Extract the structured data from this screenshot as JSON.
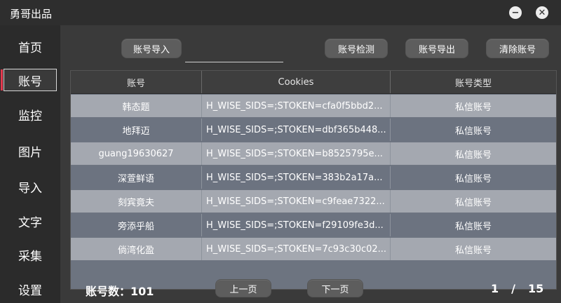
{
  "app_title": "勇哥出品",
  "window_controls": {
    "minimize": "−",
    "close": "✕"
  },
  "sidebar": {
    "items": [
      {
        "label": "首页"
      },
      {
        "label": "账号"
      },
      {
        "label": "监控"
      },
      {
        "label": "图片"
      },
      {
        "label": "导入"
      },
      {
        "label": "文字"
      },
      {
        "label": "采集"
      },
      {
        "label": "设置"
      }
    ],
    "active_index": 1,
    "accent": "#e33a4f"
  },
  "toolbar": {
    "import_label": "账号导入",
    "import_value": "",
    "detect_label": "账号检测",
    "export_label": "账号导出",
    "clear_label": "清除账号"
  },
  "table": {
    "headers": [
      "账号",
      "Cookies",
      "账号类型"
    ],
    "rows": [
      [
        "韩态题",
        "H_WISE_SIDS=;STOKEN=cfa0f5bbd2...",
        "私信账号"
      ],
      [
        "地拜迈",
        "H_WISE_SIDS=;STOKEN=dbf365b448...",
        "私信账号"
      ],
      [
        "guang19630627",
        "H_WISE_SIDS=;STOKEN=b8525795e...",
        "私信账号"
      ],
      [
        "深萱鲜语",
        "H_WISE_SIDS=;STOKEN=383b2a17a...",
        "私信账号"
      ],
      [
        "刻宾竟夫",
        "H_WISE_SIDS=;STOKEN=c9feae7322...",
        "私信账号"
      ],
      [
        "旁添乎船",
        "H_WISE_SIDS=;STOKEN=f29109fe3d...",
        "私信账号"
      ],
      [
        "倘湾化盈",
        "H_WISE_SIDS=;STOKEN=7c93c30c02...",
        "私信账号"
      ]
    ]
  },
  "footer": {
    "count_label": "账号数：101",
    "prev_label": "上一页",
    "next_label": "下一页",
    "page_current": "1",
    "page_sep": "/",
    "page_total": "15"
  }
}
